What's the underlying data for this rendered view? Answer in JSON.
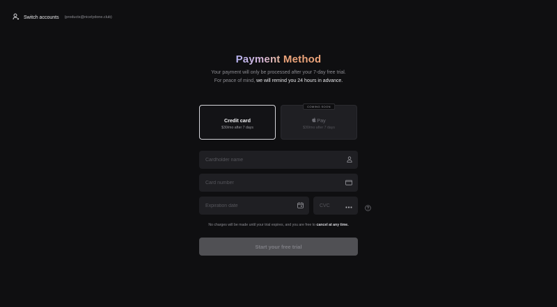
{
  "header": {
    "switch_label": "Switch accounts",
    "account_email": "(products@nicelydone.club)"
  },
  "page": {
    "title_part1": "Payment",
    "title_part2": "Method",
    "subtitle_line1": "Your payment will only be processed after your 7-day free trial.",
    "subtitle_line2_prefix": "For peace of mind, ",
    "subtitle_line2_strong": "we will remind you 24 hours in advance."
  },
  "methods": {
    "card": {
      "title": "Credit card",
      "subtitle": "$30/mo after 7 days",
      "selected": true
    },
    "apple": {
      "title": "Pay",
      "subtitle": "$30/mo after 7 days",
      "badge": "COMING SOON",
      "disabled": true
    }
  },
  "form": {
    "name_placeholder": "Cardholder name",
    "number_placeholder": "Card number",
    "expiry_placeholder": "Expiration date",
    "cvc_placeholder": "CVC"
  },
  "notice": {
    "prefix": "No charges will be made until your trial expires, and you are free to ",
    "strong": "cancel at any time."
  },
  "cta": {
    "label": "Start your free trial"
  },
  "colors": {
    "background": "#0f0f11",
    "field_background": "#1f1f23",
    "title_gradient_start": "#b7b4f3",
    "title_accent": "#eba37a",
    "cta_background": "#505054"
  },
  "icons": {
    "header": "user-icon",
    "name_field": "person-icon",
    "number_field": "card-icon",
    "expiry_field": "calendar-icon",
    "cvc_field": "dots-icon",
    "help": "help-icon",
    "apple": "apple-logo"
  }
}
